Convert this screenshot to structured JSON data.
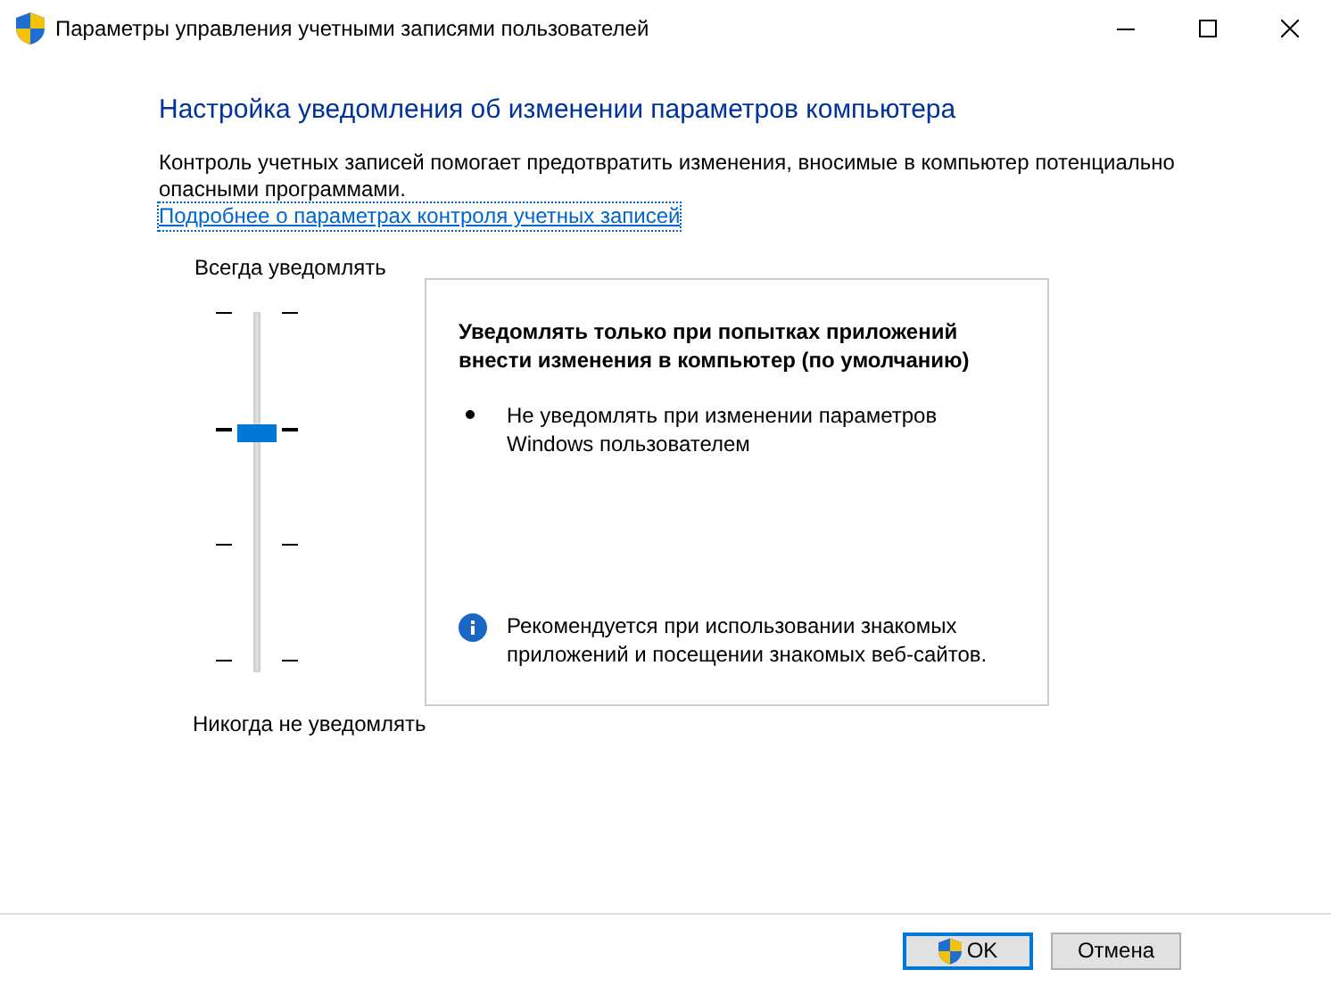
{
  "window": {
    "title": "Параметры управления учетными записями пользователей"
  },
  "heading": "Настройка уведомления об изменении параметров компьютера",
  "description": "Контроль учетных записей помогает предотвратить изменения, вносимые в компьютер потенциально опасными программами.",
  "link": "Подробнее о параметрах контроля учетных записей",
  "slider": {
    "top_label": "Всегда уведомлять",
    "bottom_label": "Никогда не уведомлять",
    "stops": [
      {
        "selected": false
      },
      {
        "selected": true
      },
      {
        "selected": false
      },
      {
        "selected": false
      }
    ]
  },
  "info": {
    "title": "Уведомлять только при попытках приложений внести изменения в компьютер (по умолчанию)",
    "bullets": [
      "Не уведомлять при изменении параметров Windows пользователем"
    ],
    "recommendation": "Рекомендуется при использовании знакомых приложений и посещении знакомых веб-сайтов."
  },
  "buttons": [
    {
      "label": "OK",
      "kind": "shield",
      "selected": true
    },
    {
      "label": "Отмена",
      "kind": "plain",
      "selected": false
    }
  ]
}
